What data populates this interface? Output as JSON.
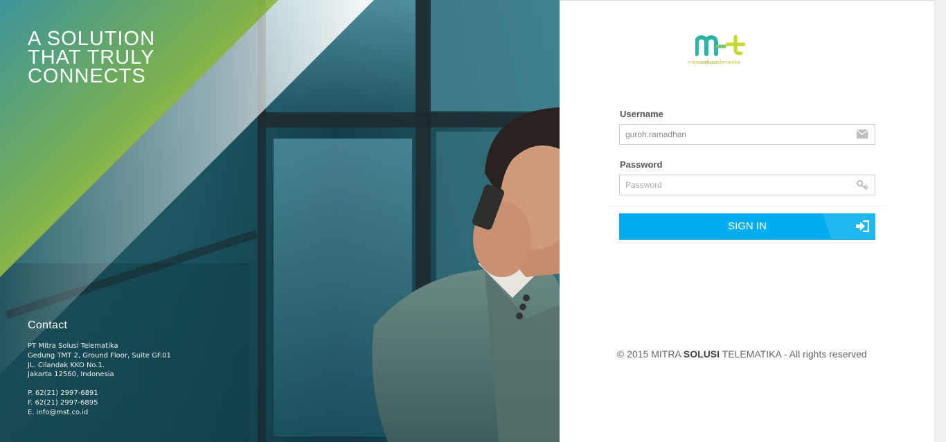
{
  "hero": {
    "tagline": [
      "A SOLUTION",
      "THAT TRULY",
      "CONNECTS"
    ],
    "contact": {
      "title": "Contact",
      "address": [
        "PT Mitra Solusi Telematika",
        "Gedung TMT 2, Ground Floor, Suite GF.01",
        "JL. Cilandak KKO No.1.",
        "Jakarta 12560, Indonesia"
      ],
      "phone": "P. 62(21) 2997-6891",
      "fax": "F. 62(21) 2997-6895",
      "email": "E. info@mst.co.id"
    }
  },
  "logo": {
    "mark": "mst",
    "sub_prefix": "mitra",
    "sub_bold": "solusi",
    "sub_suffix": "telematika"
  },
  "login": {
    "username_label": "Username",
    "username_value": "guroh.ramadhan",
    "password_label": "Password",
    "password_placeholder": "Password",
    "signin_label": "SIGN IN",
    "icons": {
      "username": "envelope-icon",
      "password": "key-icon",
      "signin": "sign-in-icon"
    }
  },
  "footer": {
    "prefix": "© 2015 MITRA ",
    "bold": "SOLUSI",
    "suffix": " TELEMATIKA - All rights reserved"
  },
  "colors": {
    "accent": "#00aeef",
    "logo_teal": "#2ab5a5",
    "logo_lime": "#c5d82e",
    "hero_yellow": "#f6d31a"
  }
}
